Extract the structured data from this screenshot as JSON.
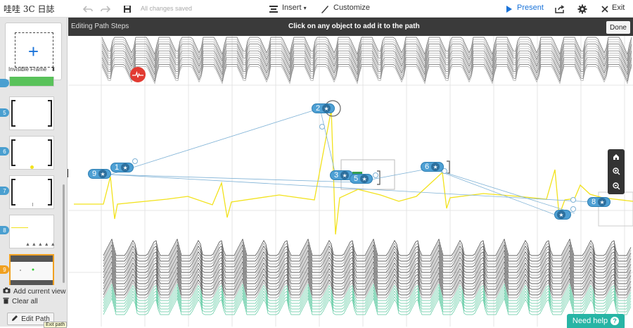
{
  "app": {
    "title": "哇哇 3C 日誌"
  },
  "toolbar": {
    "saved_status": "All changes saved",
    "insert_label": "Insert",
    "customize_label": "Customize",
    "present_label": "Present",
    "exit_label": "Exit"
  },
  "path_bar": {
    "label": "Editing Path Steps",
    "instruction": "Click on any object to add it to the path",
    "done_label": "Done"
  },
  "left_panel": {
    "frame_type": "Invisible Frame",
    "thumbnails": [
      {
        "number": "5"
      },
      {
        "number": "6"
      },
      {
        "number": "7"
      },
      {
        "number": "8"
      },
      {
        "number": "9"
      }
    ],
    "add_current_view": "Add current view",
    "clear_all": "Clear all",
    "edit_path": "Edit Path",
    "exit_path_tooltip": "Exit path"
  },
  "path_steps": [
    {
      "number": "1"
    },
    {
      "number": "2"
    },
    {
      "number": "3"
    },
    {
      "number": "5"
    },
    {
      "number": "6"
    },
    {
      "number": "8"
    },
    {
      "number": "9"
    }
  ],
  "help_button": {
    "label": "Need help"
  },
  "colors": {
    "accent": "#1a73d9",
    "pin": "#4ea0d4",
    "help": "#27b5a5",
    "ecg_line": "#f2e21c",
    "pathbar": "#3a3a3a"
  }
}
